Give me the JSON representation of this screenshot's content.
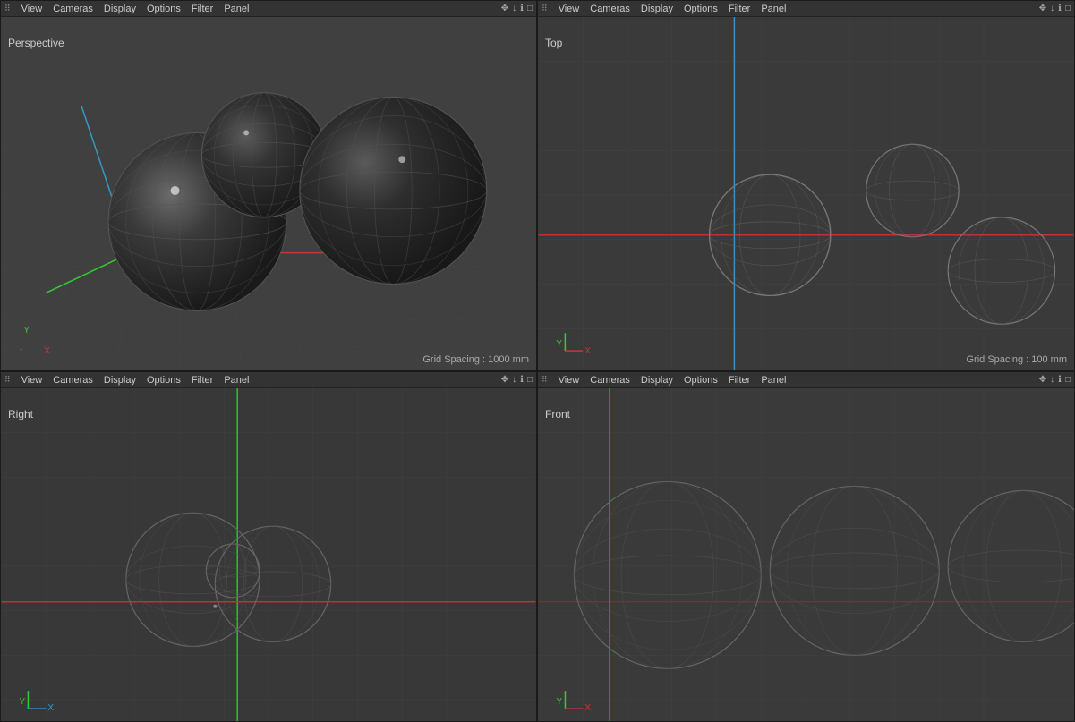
{
  "viewports": [
    {
      "id": "perspective",
      "label": "Perspective",
      "menu": [
        "View",
        "Cameras",
        "Display",
        "Options",
        "Filter",
        "Panel"
      ],
      "grid_spacing": "Grid Spacing : 1000 mm",
      "position": "top-left"
    },
    {
      "id": "top",
      "label": "Top",
      "menu": [
        "View",
        "Cameras",
        "Display",
        "Options",
        "Filter",
        "Panel"
      ],
      "grid_spacing": "Grid Spacing : 100 mm",
      "position": "top-right"
    },
    {
      "id": "right",
      "label": "Right",
      "menu": [
        "View",
        "Cameras",
        "Display",
        "Options",
        "Filter",
        "Panel"
      ],
      "grid_spacing": "",
      "position": "bottom-left"
    },
    {
      "id": "front",
      "label": "Front",
      "menu": [
        "View",
        "Cameras",
        "Display",
        "Options",
        "Filter",
        "Panel"
      ],
      "grid_spacing": "",
      "position": "bottom-right"
    }
  ],
  "colors": {
    "background": "#3c3c3c",
    "menubar": "#333333",
    "text": "#cccccc",
    "grid": "#4a4a4a",
    "axis_x": "#cc3333",
    "axis_y": "#3399cc",
    "axis_z": "#33cc33",
    "sphere_dark": "#2a2a2a",
    "sphere_wire": "#666666"
  }
}
